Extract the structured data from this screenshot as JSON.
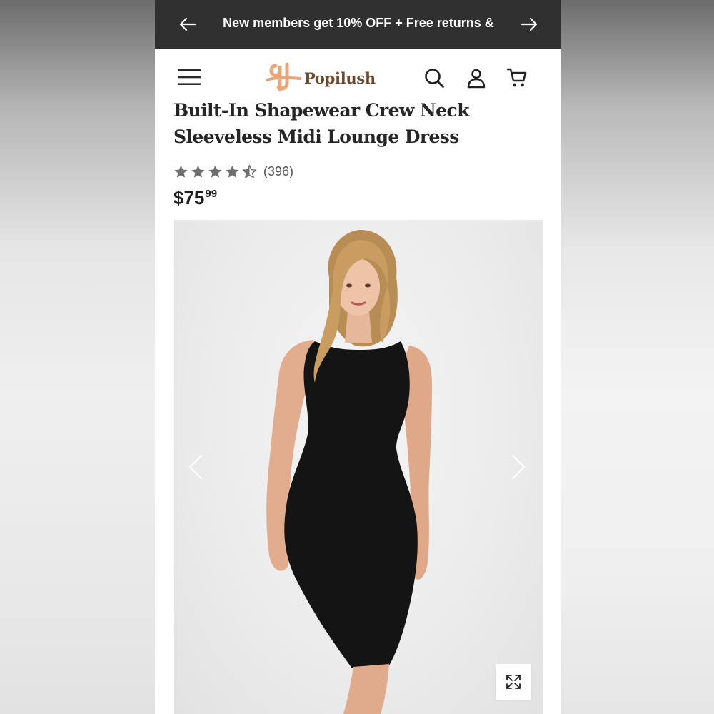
{
  "promo_bar": {
    "text": "New members get 10% OFF + Free returns &",
    "prev_icon": "arrow-left-icon",
    "next_icon": "arrow-right-icon",
    "background": "#303030"
  },
  "header": {
    "menu_icon": "hamburger-menu-icon",
    "brand": "Popilush",
    "brand_color": "#6b4a2e",
    "logo_accent": "#e8a679",
    "icons": [
      "search-icon",
      "account-icon",
      "cart-icon"
    ]
  },
  "product": {
    "title": "Built-In Shapewear Crew Neck Sleeveless Midi Lounge Dress",
    "rating": 4.5,
    "stars_max": 5,
    "review_count": "(396)",
    "price_dollars": "$75",
    "price_cents": "99"
  },
  "gallery": {
    "image": "model-in-black-sleeveless-midi-dress",
    "prev_icon": "chevron-left-icon",
    "next_icon": "chevron-right-icon",
    "expand_icon": "expand-icon"
  }
}
